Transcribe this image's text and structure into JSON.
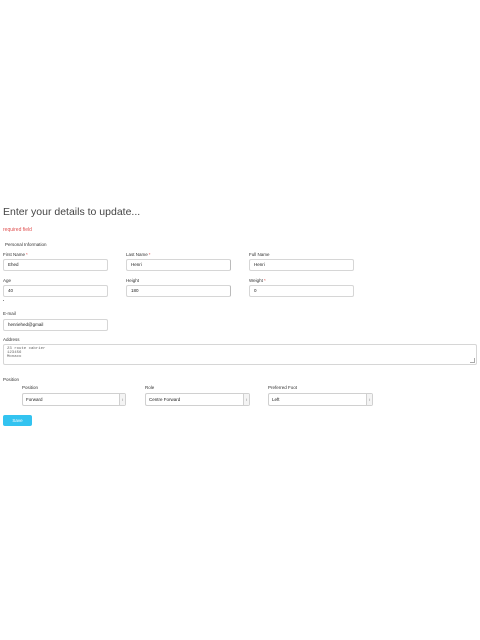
{
  "form": {
    "title": "Enter your details to update...",
    "required_note": "required field",
    "personal_section": "Personal Information",
    "fields": {
      "first_name": {
        "label": "First Name",
        "value": "Ehed"
      },
      "last_name": {
        "label": "Last Name",
        "value": "Henri"
      },
      "full_name": {
        "label": "Full Name",
        "value": "Henri"
      },
      "age": {
        "label": "Age",
        "value": "40"
      },
      "height": {
        "label": "Height",
        "value": "180"
      },
      "weight": {
        "label": "Weight",
        "value": "0"
      },
      "email": {
        "label": "E-mail",
        "value": "henriehed@gmail"
      },
      "address": {
        "label": "Address",
        "value": "23 route cabrier\n123456\nMonaco"
      }
    },
    "position_section": "Position",
    "selects": {
      "position": {
        "label": "Position",
        "value": "Forward"
      },
      "role": {
        "label": "Role",
        "value": "Centre Forward"
      },
      "preferred_foot": {
        "label": "Preferred Foot",
        "value": "Left"
      }
    },
    "save_label": "Save"
  }
}
